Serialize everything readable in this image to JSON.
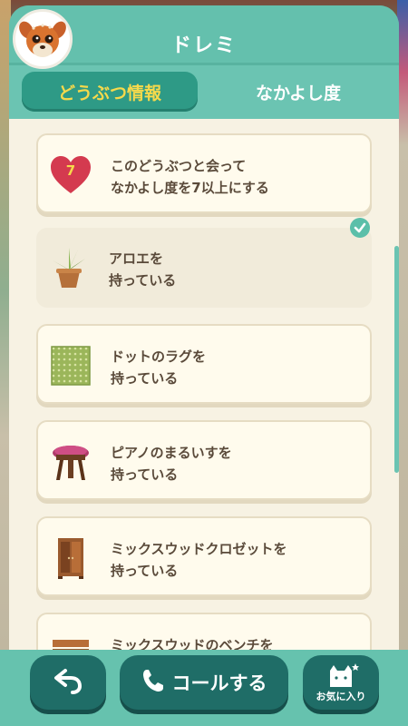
{
  "header": {
    "title": "ドレミ"
  },
  "tabs": [
    {
      "label": "どうぶつ情報",
      "active": true
    },
    {
      "label": "なかよし度",
      "active": false
    }
  ],
  "requirements": [
    {
      "text_line1": "このどうぶつと会って",
      "text_line2": "なかよし度を7以上にする",
      "icon": "heart-icon",
      "badge": "7",
      "completed": false
    },
    {
      "text_line1": "アロエを",
      "text_line2": "持っている",
      "icon": "aloe-plant-icon",
      "completed": true
    },
    {
      "text_line1": "ドットのラグを",
      "text_line2": "持っている",
      "icon": "dot-rug-icon",
      "completed": false
    },
    {
      "text_line1": "ピアノのまるいすを",
      "text_line2": "持っている",
      "icon": "piano-stool-icon",
      "completed": false
    },
    {
      "text_line1": "ミックスウッドクロゼットを",
      "text_line2": "持っている",
      "icon": "wooden-closet-icon",
      "completed": false
    },
    {
      "text_line1": "ミックスウッドのベンチを",
      "text_line2": "",
      "icon": "wooden-bench-icon",
      "completed": false
    }
  ],
  "footer": {
    "back_icon": "back-arrow-icon",
    "call_label": "コールする",
    "call_icon": "phone-icon",
    "favorite_label": "お気に入り",
    "favorite_icon": "cat-star-icon"
  },
  "colors": {
    "accent": "#64c0ad",
    "tab_active_bg": "#2e9a86",
    "tab_active_text": "#f6d94b",
    "button_bg": "#1f6d67",
    "card_bg": "#fffbed",
    "text": "#5a4a3a",
    "check": "#5bbfa9"
  }
}
